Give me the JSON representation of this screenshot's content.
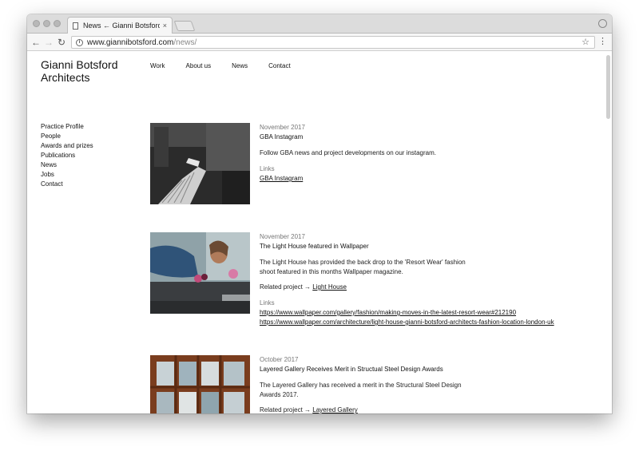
{
  "browser": {
    "tab_title": "News ← Gianni Botsford Archi",
    "tab_close": "×",
    "url_host": "www.giannibotsford.com",
    "url_path": "/news/"
  },
  "site": {
    "logo_line1": "Gianni Botsford",
    "logo_line2": "Architects",
    "topnav": [
      "Work",
      "About us",
      "News",
      "Contact"
    ],
    "sidenav": [
      "Practice Profile",
      "People",
      "Awards and prizes",
      "Publications",
      "News",
      "Jobs",
      "Contact"
    ]
  },
  "posts": [
    {
      "date": "November 2017",
      "title": "GBA Instagram",
      "body": "Follow GBA news and project developments on our instagram.",
      "links_label": "Links",
      "links": [
        "GBA Instagram"
      ]
    },
    {
      "date": "November 2017",
      "title": "The Light House featured in Wallpaper",
      "body": "The Light House has provided the back drop to the 'Resort Wear' fashion shoot featured in this months Wallpaper magazine.",
      "related_prefix": "Related project →",
      "related_link": "Light House",
      "links_label": "Links",
      "links": [
        "https://www.wallpaper.com/gallery/fashion/making-moves-in-the-latest-resort-wear#212190",
        "https://www.wallpaper.com/architecture/light-house-gianni-botsford-architects-fashion-location-london-uk"
      ]
    },
    {
      "date": "October 2017",
      "title": "Layered Gallery Receives Merit in Structual Steel Design Awards",
      "body": "The Layered Gallery has received a merit in the Structural Steel Design Awards 2017.",
      "related_prefix": "Related project →",
      "related_link": "Layered Gallery"
    }
  ]
}
